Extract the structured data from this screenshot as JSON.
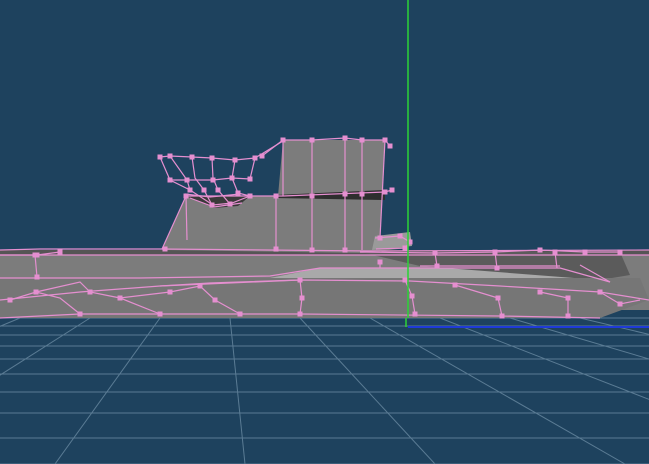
{
  "viewport": {
    "kind": "3d-perspective-viewport",
    "background_color": "#1e425e",
    "grid_color": "#6f8fa6",
    "wireframe_color": "#e58fd0",
    "vertex_color": "#e58fd0",
    "mesh_fill_color": "#7c7c7c",
    "mesh_dark_fill_color": "#555555",
    "mesh_light_fill_color": "#a9a9a9",
    "y_axis_color": "#2bd336",
    "x_axis_color": "#1f3ad8",
    "model_name": "submarine-hull-mesh",
    "grid_visible": true,
    "axes_visible": true
  }
}
